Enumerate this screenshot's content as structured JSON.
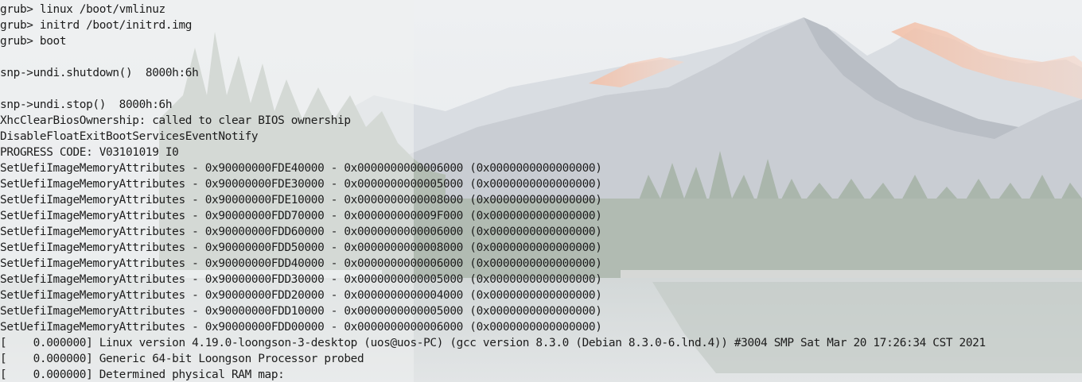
{
  "background": {
    "description_icon": "mountain-lake-wallpaper-icon",
    "sky_color": "#e8ebee",
    "mountain_color": "#c8ccd2",
    "peak_glow_color": "#f0b9a3",
    "forest_color": "#a9b5ac",
    "water_color": "#cfd4d6"
  },
  "terminal": {
    "text_color": "#1c1c1c",
    "lines": [
      "grub> linux /boot/vmlinuz",
      "grub> initrd /boot/initrd.img",
      "grub> boot",
      "",
      "snp->undi.shutdown()  8000h:6h",
      "",
      "snp->undi.stop()  8000h:6h",
      "XhcClearBiosOwnership: called to clear BIOS ownership",
      "DisableFloatExitBootServicesEventNotify",
      "PROGRESS CODE: V03101019 I0",
      "SetUefiImageMemoryAttributes - 0x90000000FDE40000 - 0x0000000000006000 (0x0000000000000000)",
      "SetUefiImageMemoryAttributes - 0x90000000FDE30000 - 0x0000000000005000 (0x0000000000000000)",
      "SetUefiImageMemoryAttributes - 0x90000000FDE10000 - 0x0000000000008000 (0x0000000000000000)",
      "SetUefiImageMemoryAttributes - 0x90000000FDD70000 - 0x000000000009F000 (0x0000000000000000)",
      "SetUefiImageMemoryAttributes - 0x90000000FDD60000 - 0x0000000000006000 (0x0000000000000000)",
      "SetUefiImageMemoryAttributes - 0x90000000FDD50000 - 0x0000000000008000 (0x0000000000000000)",
      "SetUefiImageMemoryAttributes - 0x90000000FDD40000 - 0x0000000000006000 (0x0000000000000000)",
      "SetUefiImageMemoryAttributes - 0x90000000FDD30000 - 0x0000000000005000 (0x0000000000000000)",
      "SetUefiImageMemoryAttributes - 0x90000000FDD20000 - 0x0000000000004000 (0x0000000000000000)",
      "SetUefiImageMemoryAttributes - 0x90000000FDD10000 - 0x0000000000005000 (0x0000000000000000)",
      "SetUefiImageMemoryAttributes - 0x90000000FDD00000 - 0x0000000000006000 (0x0000000000000000)",
      "[    0.000000] Linux version 4.19.0-loongson-3-desktop (uos@uos-PC) (gcc version 8.3.0 (Debian 8.3.0-6.lnd.4)) #3004 SMP Sat Mar 20 17:26:34 CST 2021",
      "[    0.000000] Generic 64-bit Loongson Processor probed",
      "[    0.000000] Determined physical RAM map:"
    ]
  }
}
